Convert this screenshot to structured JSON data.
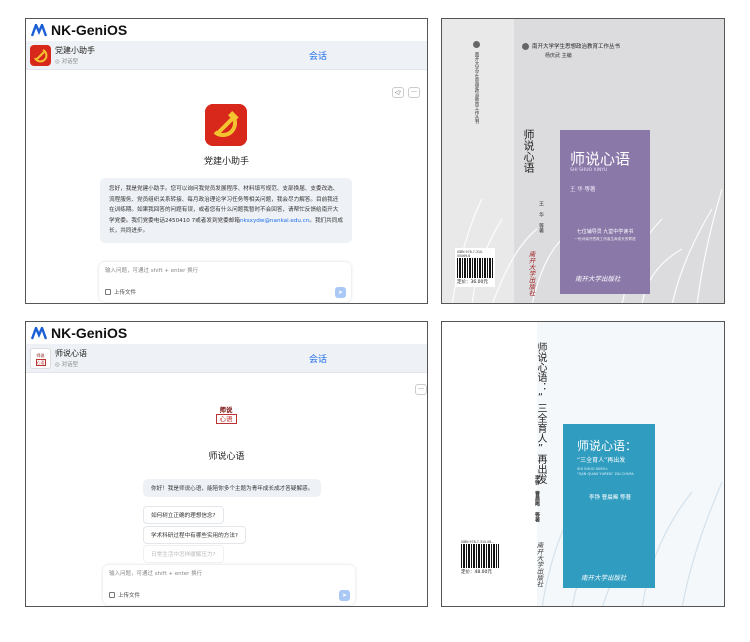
{
  "brand": {
    "name": "NK-GeniOS"
  },
  "panel1": {
    "bot_name": "党建小助手",
    "sub_label": "对话型",
    "center_title": "会话",
    "logo_title": "党建小助手",
    "intro_before": "您好，我是党建小助手。您可以询问我党员发展程序、材料填写规范、支部换届、支委改选、流程服务、党员组织关系转接、每月政治理论学习任务等相关问题，我会尽力解答。目前我还在训练期。如果我回答的问题有误，或者您有什么问题我暂时不会回答，请帮忙反馈给南开大学党委。我们党委电话2450410 7或者发到党委邮箱",
    "intro_email": "nksxydw@nankai.edu.cn",
    "intro_after": "。我们共同成长，共同进步。",
    "input_placeholder": "输入问题，可通过 shift + enter 换行",
    "upload_label": "上传文件"
  },
  "panel2": {
    "series_title": "南开大学学生思想政治教育工作丛书",
    "series_editor": "杨庆武  主编",
    "spine_series": "南开大学学生思想政治教育工作丛书",
    "spine_title": "师说心语",
    "spine_author": "王 华 等著",
    "spine_publisher": "南开大学出版社",
    "title": "师说心语",
    "pinyin": "SHI SHUO XINYU",
    "author": "王  华  等著",
    "tagline1": "七位辅导员  九堂中学读书",
    "tagline2": "一份对南开思政工作者生命成长的寄语",
    "publisher": "南开大学出版社",
    "isbn": "ISBN 978-7-310-05069-6",
    "price": "定价：36.00元"
  },
  "panel3": {
    "bot_name": "师说心语",
    "sub_label": "对话型",
    "center_title": "会话",
    "logo_line1": "师说",
    "logo_line2": "心语",
    "logo_title": "师说心语",
    "greeting": "你好！我是师说心语，能陪你多个主题为青年成长成才答疑解惑。",
    "suggestions": [
      "如何树立正确的理想信念?",
      "学术科研过程中有哪些实用的方法?",
      "日常生活中怎样缓解压力?"
    ],
    "input_placeholder": "输入问题，可通过 shift + enter 换行",
    "upload_label": "上传文件"
  },
  "panel4": {
    "spine_title": "师说心语：“三全育人”再出发",
    "spine_author": "李铮  曹晨晞  等著",
    "spine_publisher": "南开大学出版社",
    "title": "师说心语：",
    "subtitle": "“三全育人”再出发",
    "pinyin1": "SHI SHUO XINYU:",
    "pinyin2": "“SAN QUAN YUREN” ZAI CHUFA",
    "author": "李铮  曹晨晞  等著",
    "publisher": "南开大学出版社",
    "isbn": "ISBN 978-7-310-06...",
    "price": "定价：48.00元"
  },
  "colors": {
    "accent": "#1f6feb",
    "brand_blue": "#1a5fd6",
    "cover_purple": "#8a78a9",
    "cover_teal": "#2f9cc0",
    "party_red": "#d8281c"
  }
}
